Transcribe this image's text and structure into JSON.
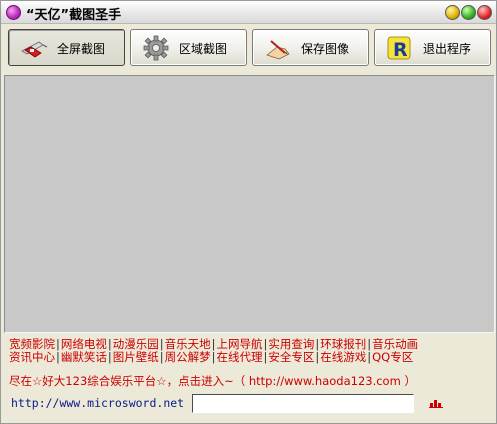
{
  "window": {
    "title": "“天亿”截图圣手"
  },
  "toolbar": {
    "full_screen_label": "全屏截图",
    "region_label": "区域截图",
    "save_label": "保存图像",
    "exit_label": "退出程序"
  },
  "links": {
    "row1": [
      "宽频影院",
      "网络电视",
      "动漫乐园",
      "音乐天地",
      "上网导航",
      "实用查询",
      "环球报刊",
      "音乐动画"
    ],
    "row2": [
      "资讯中心",
      "幽默笑话",
      "图片壁纸",
      "周公解梦",
      "在线代理",
      "安全专区",
      "在线游戏",
      "QQ专区"
    ]
  },
  "promo": {
    "text": "尽在☆好大123综合娱乐平台☆，点击进入~（ http://www.haoda123.com ）"
  },
  "bottom": {
    "url_text": "http://www.microsword.net",
    "input_value": ""
  },
  "colors": {
    "link_red": "#cc0000",
    "url_blue": "#0a1a8a",
    "window_bg": "#ece9d8",
    "preview_bg": "#c8c8c8"
  },
  "icons": {
    "app": "purple-ball-icon",
    "full_screen": "red-knife-icon",
    "region": "gear-icon",
    "save": "hand-pen-icon",
    "exit": "r-logo-icon"
  }
}
